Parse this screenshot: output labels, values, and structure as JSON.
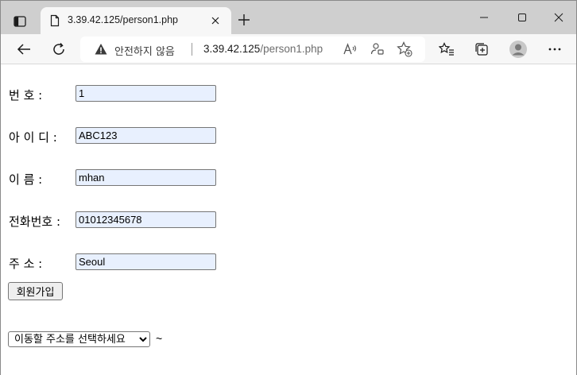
{
  "browser": {
    "tab": {
      "title": "3.39.42.125/person1.php"
    },
    "address": {
      "security_label": "안전하지 않음",
      "host": "3.39.42.125",
      "path": "/person1.php"
    }
  },
  "form": {
    "fields": [
      {
        "label": "번 호 :",
        "value": "1"
      },
      {
        "label": "아 이 디 :",
        "value": "ABC123"
      },
      {
        "label": "이 름 :",
        "value": "mhan"
      },
      {
        "label": "전화번호 :",
        "value": "01012345678"
      },
      {
        "label": "주 소 :",
        "value": "Seoul"
      }
    ],
    "submit_label": "회원가입"
  },
  "navigation": {
    "select_value": "이동할 주소를 선택하세요",
    "trailing_text": "~"
  },
  "colors": {
    "tabstrip": "#cfcfcf",
    "toolbar": "#f7f7f7",
    "autofill": "#e8f0fe"
  }
}
